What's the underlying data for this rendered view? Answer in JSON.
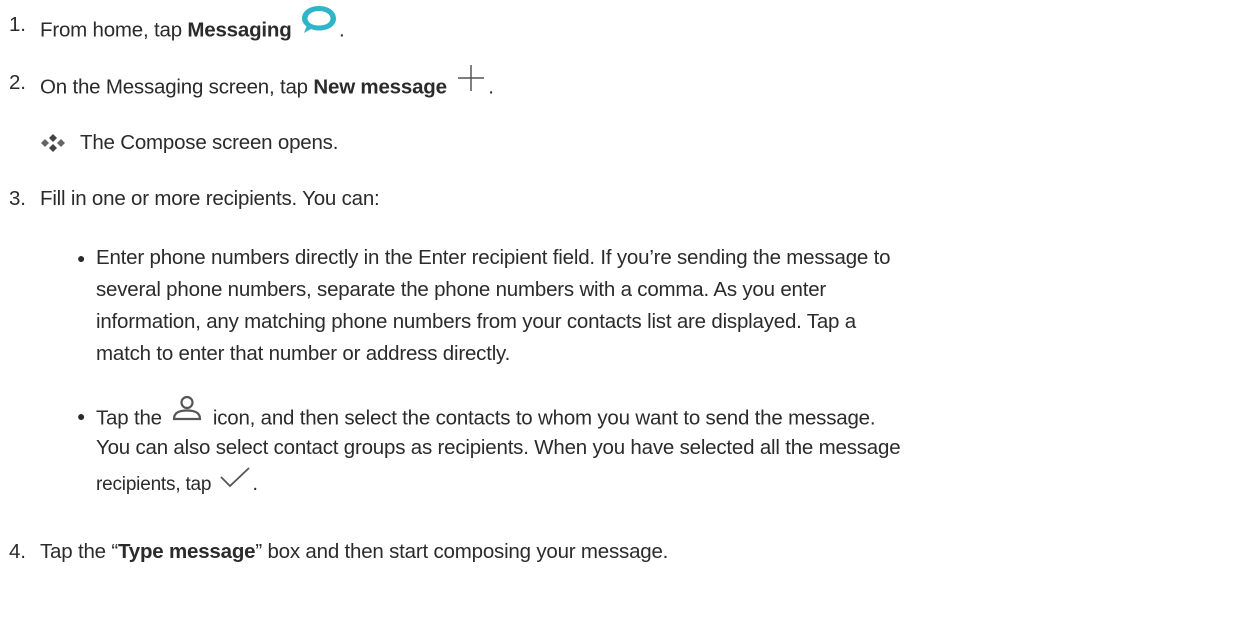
{
  "steps": [
    {
      "num": "1.",
      "pre": "From home, tap ",
      "bold": "Messaging",
      "post": ".",
      "icon": "messaging-bubble-icon"
    },
    {
      "num": "2.",
      "pre": "On the Messaging screen, tap ",
      "bold": "New message",
      "post": ".",
      "icon": "plus-icon"
    },
    {
      "num": "3.",
      "text": "Fill in one or more recipients. You can:"
    },
    {
      "num": "4.",
      "pre": "Tap the “",
      "bold": "Type message",
      "post": "” box and then start composing your message."
    }
  ],
  "result": {
    "icon": "diamond-bullet-icon",
    "text": "The Compose screen opens."
  },
  "bullets": [
    {
      "lines": [
        "Enter phone numbers directly in the Enter recipient field. If you’re sending the message to",
        "several phone numbers, separate the phone numbers with a comma. As you enter",
        "information, any matching phone numbers from your contacts list are displayed. Tap a",
        "match to enter that number or address directly."
      ]
    },
    {
      "line1_pre": "Tap the ",
      "line1_post": " icon, and then select the contacts to whom you want to send the message.",
      "line2": "You can also select contact groups as recipients. When you have selected all the message",
      "line3_pre": "recipients, tap ",
      "line3_post": ".",
      "icons": [
        "contact-person-icon",
        "checkmark-icon"
      ]
    }
  ],
  "colors": {
    "text": "#2b2b2b",
    "messaging_icon": "#2fb5c7",
    "icon_gray": "#555555"
  }
}
